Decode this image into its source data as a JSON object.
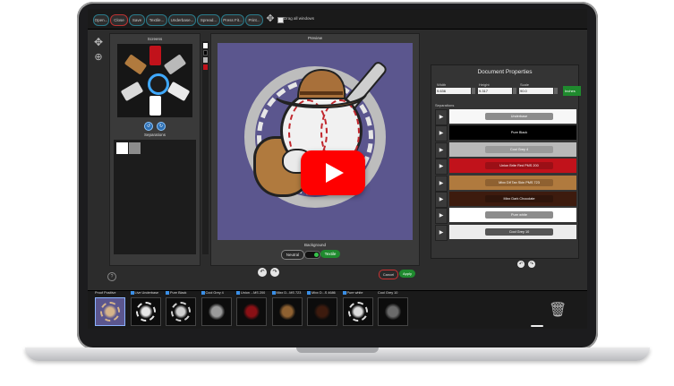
{
  "toolbar": {
    "buttons": [
      "Open...",
      "Close",
      "Save",
      "Textile...",
      "Underbase...",
      "Spread...",
      "Press Fit...",
      "Print..."
    ],
    "drag_all_label": "Drag all windows"
  },
  "screens_panel": {
    "title": "Screens",
    "separations_label": "Separations"
  },
  "preview_panel": {
    "title": "Preview",
    "background_label": "Background",
    "neutral_label": "Neutral",
    "textile_label": "Textile",
    "cancel_label": "Cancel",
    "apply_label": "Apply"
  },
  "help_glyph": "?",
  "document_properties": {
    "title": "Document Properties",
    "width_label": "Width",
    "width_value": "9.636",
    "height_label": "Height",
    "height_value": "9.317",
    "scale_label": "Scale",
    "scale_value": "90.0",
    "units_label": "Inches",
    "separations_label": "Separations",
    "separations": [
      {
        "name": "Underbase",
        "bar_color": "#f7f7f7",
        "label_bg": "#8c8c8c",
        "label_color": "#ffffff"
      },
      {
        "name": "Pure Black",
        "bar_color": "#000000",
        "label_bg": "#000000",
        "label_color": "#ffffff"
      },
      {
        "name": "Cool Grey 4",
        "bar_color": "#b9b9b9",
        "label_bg": "#9a9a9a",
        "label_color": "#ffffff"
      },
      {
        "name": "Union Brite Red PMS 200",
        "bar_color": "#c1121b",
        "label_bg": "#9b0f16",
        "label_color": "#ffffff"
      },
      {
        "name": "Mixx Dif Tan Skin PMS 723",
        "bar_color": "#b07a3e",
        "label_bg": "#8f6131",
        "label_color": "#ffffff"
      },
      {
        "name": "Mixx Dark Chocolate",
        "bar_color": "#3d1b0e",
        "label_bg": "#2f150b",
        "label_color": "#ffffff"
      },
      {
        "name": "Pure white",
        "bar_color": "#ffffff",
        "label_bg": "#8c8c8c",
        "label_color": "#ffffff"
      },
      {
        "name": "Cool Grey 10",
        "bar_color": "#ececec",
        "label_bg": "#555555",
        "label_color": "#ffffff"
      }
    ]
  },
  "thumbnails": [
    {
      "label": "Proof Positive",
      "checked": false
    },
    {
      "label": "Live Underbase",
      "checked": true
    },
    {
      "label": "Pure Black",
      "checked": true
    },
    {
      "label": "Cool Grey 4",
      "checked": true
    },
    {
      "label": "Union ...MS 200",
      "checked": true
    },
    {
      "label": "Mixx D...MS 723",
      "checked": true
    },
    {
      "label": "Mixx D...S 4686",
      "checked": true
    },
    {
      "label": "Pure white",
      "checked": true
    },
    {
      "label": "Cool Grey 10",
      "checked": false
    }
  ],
  "colors": {
    "accent_blue": "#3fa9ff",
    "apply_green": "#1f8a2e",
    "cancel_red": "#cc3333",
    "youtube_red": "#ff0000"
  }
}
